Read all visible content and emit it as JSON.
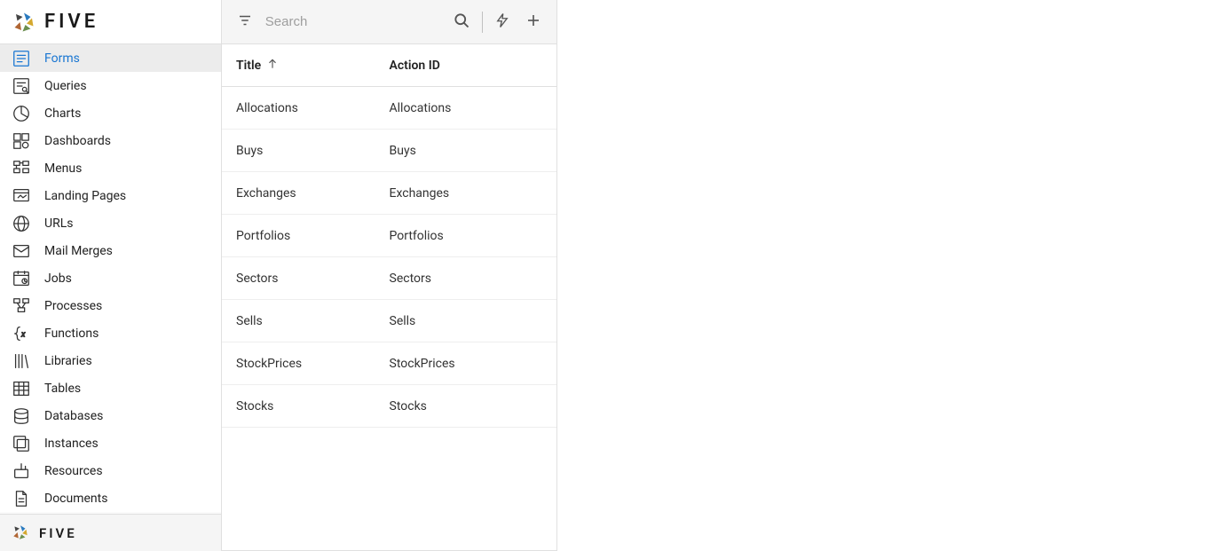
{
  "brand": {
    "name": "FIVE",
    "footerName": "FIVE"
  },
  "search": {
    "placeholder": "Search"
  },
  "sidebar": {
    "activeIndex": 0,
    "items": [
      {
        "label": "Forms",
        "icon": "form-icon"
      },
      {
        "label": "Queries",
        "icon": "query-icon"
      },
      {
        "label": "Charts",
        "icon": "chart-icon"
      },
      {
        "label": "Dashboards",
        "icon": "dashboard-icon"
      },
      {
        "label": "Menus",
        "icon": "menu-icon"
      },
      {
        "label": "Landing Pages",
        "icon": "landing-icon"
      },
      {
        "label": "URLs",
        "icon": "url-icon"
      },
      {
        "label": "Mail Merges",
        "icon": "mail-icon"
      },
      {
        "label": "Jobs",
        "icon": "job-icon"
      },
      {
        "label": "Processes",
        "icon": "process-icon"
      },
      {
        "label": "Functions",
        "icon": "function-icon"
      },
      {
        "label": "Libraries",
        "icon": "library-icon"
      },
      {
        "label": "Tables",
        "icon": "table-icon"
      },
      {
        "label": "Databases",
        "icon": "database-icon"
      },
      {
        "label": "Instances",
        "icon": "instance-icon"
      },
      {
        "label": "Resources",
        "icon": "resource-icon"
      },
      {
        "label": "Documents",
        "icon": "document-icon"
      }
    ]
  },
  "table": {
    "columns": {
      "title": "Title",
      "actionId": "Action ID"
    },
    "sortAscending": true,
    "rows": [
      {
        "title": "Allocations",
        "actionId": "Allocations"
      },
      {
        "title": "Buys",
        "actionId": "Buys"
      },
      {
        "title": "Exchanges",
        "actionId": "Exchanges"
      },
      {
        "title": "Portfolios",
        "actionId": "Portfolios"
      },
      {
        "title": "Sectors",
        "actionId": "Sectors"
      },
      {
        "title": "Sells",
        "actionId": "Sells"
      },
      {
        "title": "StockPrices",
        "actionId": "StockPrices"
      },
      {
        "title": "Stocks",
        "actionId": "Stocks"
      }
    ]
  }
}
